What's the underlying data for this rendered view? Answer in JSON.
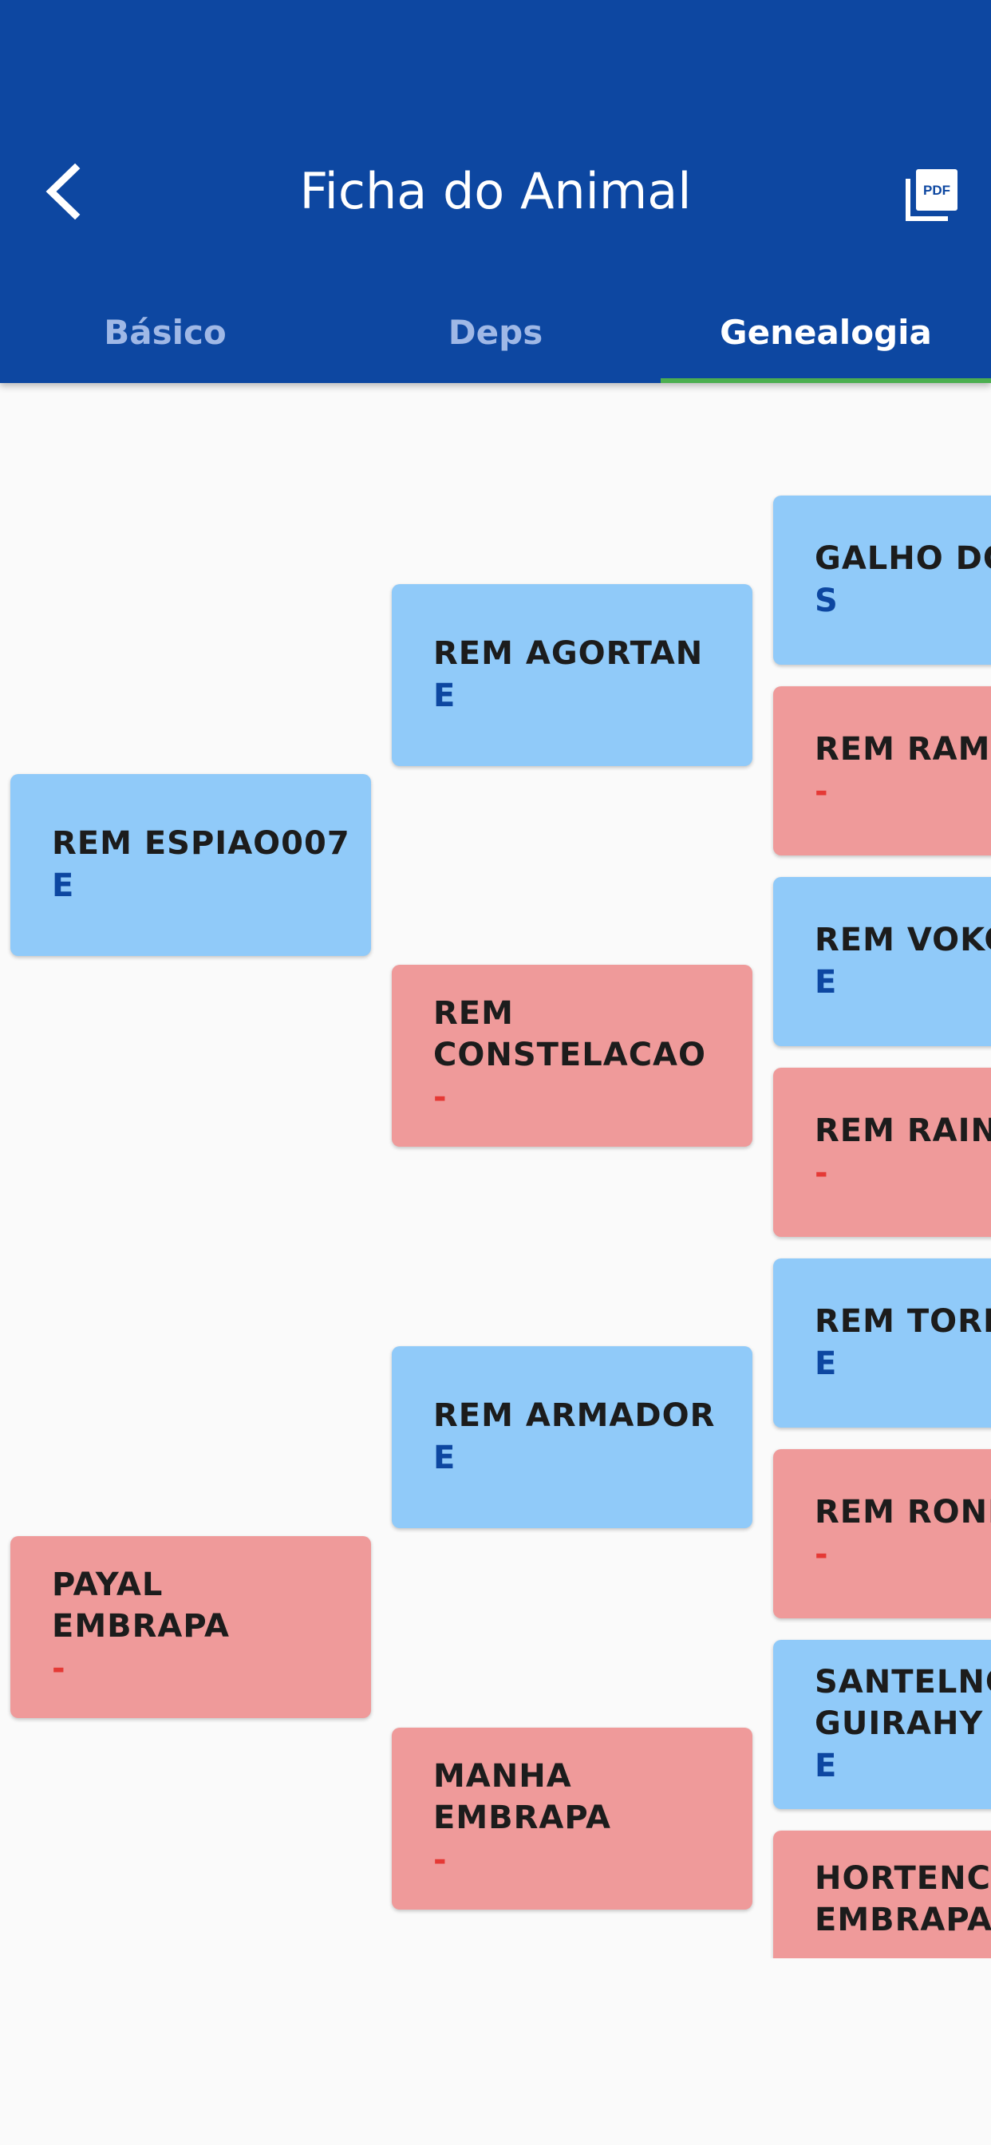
{
  "header": {
    "title": "Ficha do Animal",
    "back_icon": "chevron-left-icon",
    "pdf_icon": "pdf-icon",
    "colors": {
      "appbar": "#0d47a1",
      "tab_indicator": "#4caf50"
    }
  },
  "tabs": [
    {
      "label": "Básico",
      "active": false
    },
    {
      "label": "Deps",
      "active": false
    },
    {
      "label": "Genealogia",
      "active": true
    }
  ],
  "pedigree": {
    "parents": [
      {
        "name": "REM ESPIAO007",
        "grade": "E",
        "sex": "male"
      },
      {
        "name": "PAYAL\nEMBRAPA",
        "grade": "-",
        "sex": "female"
      }
    ],
    "grandparents": [
      {
        "name": "REM AGORTAN",
        "grade": "E",
        "sex": "male"
      },
      {
        "name": "REM\nCONSTELACAO",
        "grade": "-",
        "sex": "female"
      },
      {
        "name": "REM ARMADOR",
        "grade": "E",
        "sex": "male"
      },
      {
        "name": "MANHA\nEMBRAPA",
        "grade": "-",
        "sex": "female"
      }
    ],
    "great_grandparents": [
      {
        "name": "GALHO DO",
        "grade": "S",
        "sex": "male"
      },
      {
        "name": "REM RAMIS",
        "grade": "-",
        "sex": "female"
      },
      {
        "name": "REM VOKO",
        "grade": "E",
        "sex": "male"
      },
      {
        "name": "REM RAINA",
        "grade": "-",
        "sex": "female"
      },
      {
        "name": "REM TORIX",
        "grade": "E",
        "sex": "male"
      },
      {
        "name": "REM ROND",
        "grade": "-",
        "sex": "female"
      },
      {
        "name": "SANTELNO\nGUIRAHY",
        "grade": "E",
        "sex": "male"
      },
      {
        "name": "HORTENCI\nEMBRAPA",
        "grade": "",
        "sex": "female"
      }
    ]
  }
}
